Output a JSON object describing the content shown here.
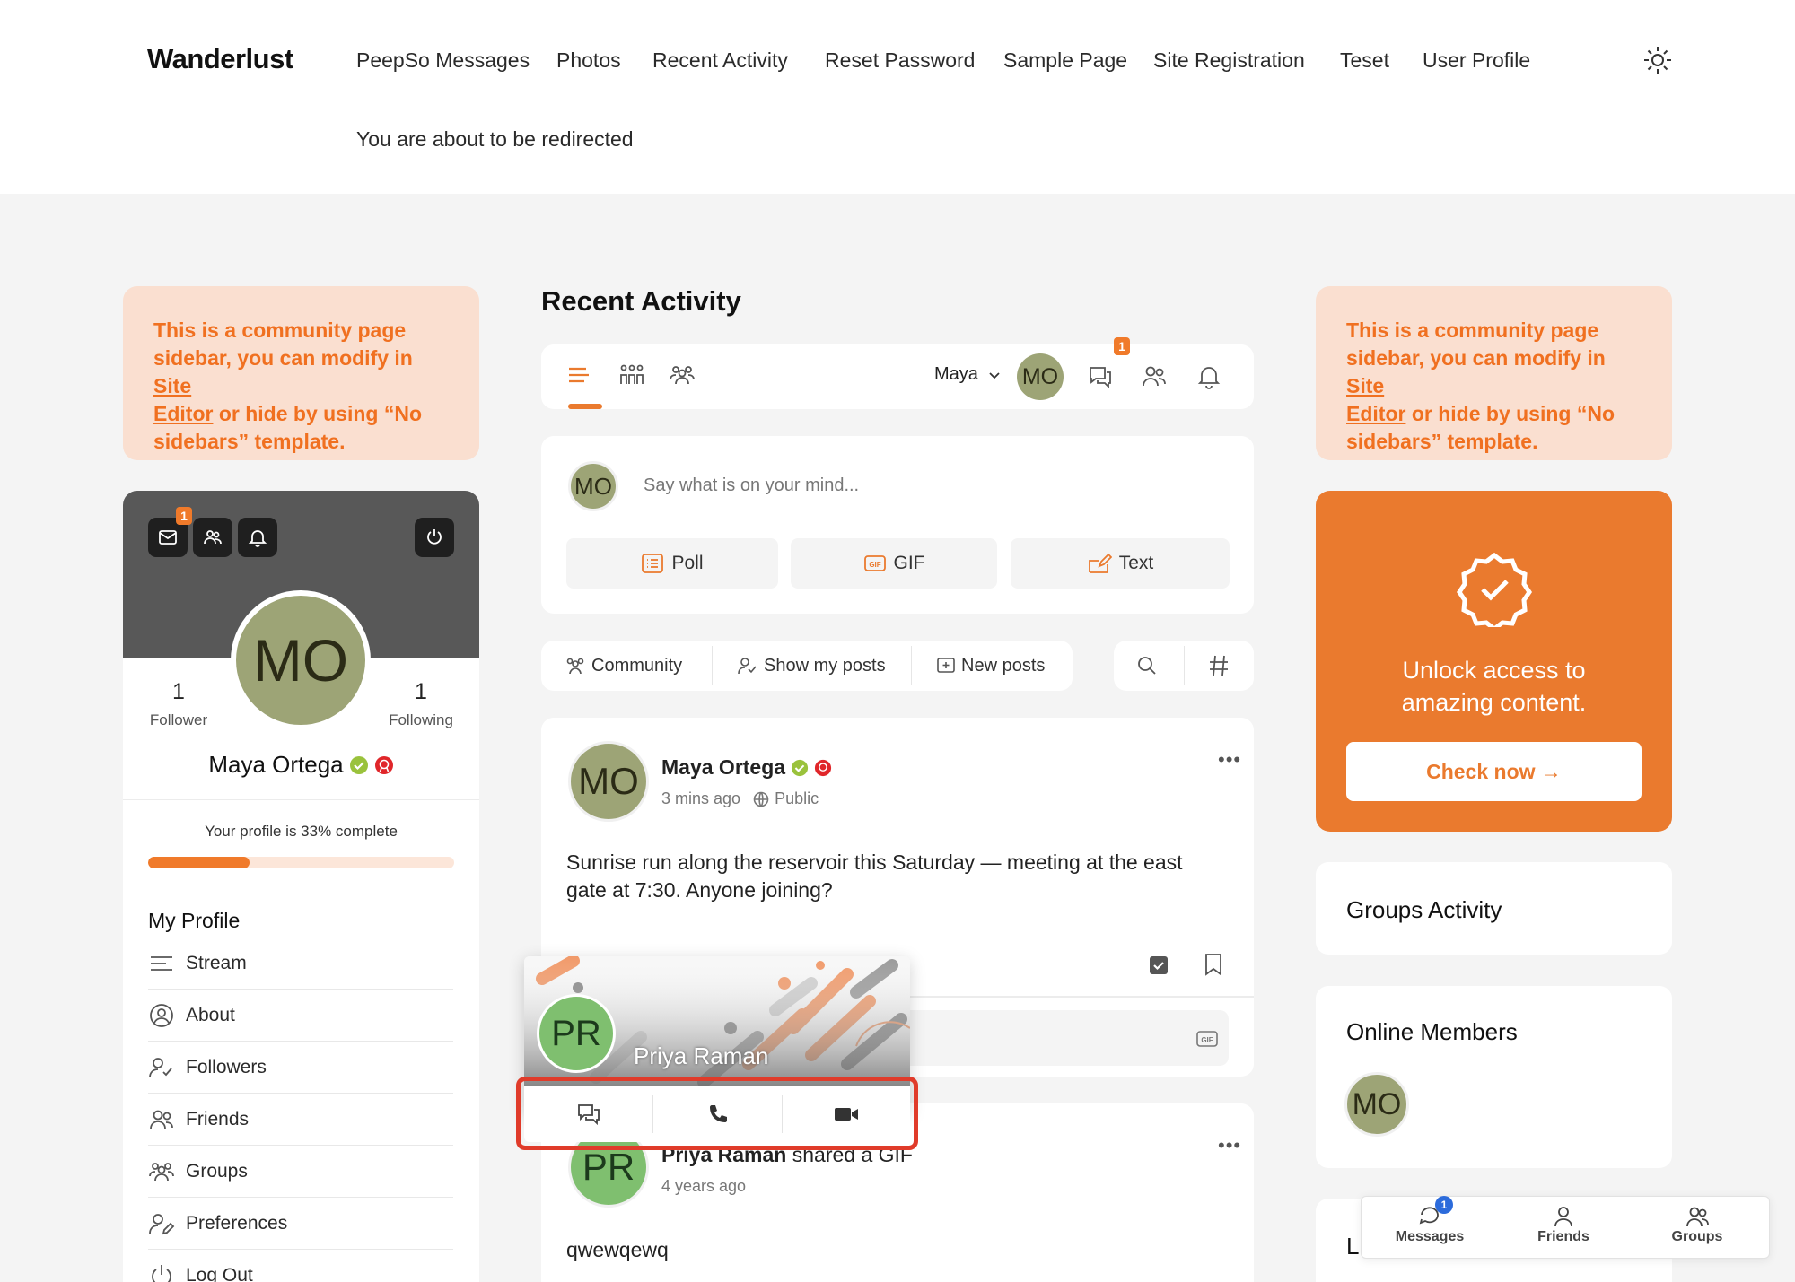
{
  "site": {
    "brand": "Wanderlust"
  },
  "nav": {
    "items": [
      "PeepSo Messages",
      "Photos",
      "Recent Activity",
      "Reset Password",
      "Sample Page",
      "Site Registration",
      "Teset",
      "User Profile"
    ],
    "redirect_text": "You are about to be redirected"
  },
  "sidebar_notice": {
    "line1": "This is a community page",
    "line2_pre": "sidebar, you can modify in ",
    "link1": "Site",
    "link2": "Editor",
    "line3_post": " or hide by using “No",
    "line4": "sidebars” template."
  },
  "profile": {
    "initials": "MO",
    "name": "Maya Ortega",
    "message_badge": "1",
    "followers_count": "1",
    "followers_label": "Follower",
    "following_count": "1",
    "following_label": "Following",
    "complete_text": "Your profile is 33% complete",
    "complete_fraction": 0.33,
    "section_title": "My Profile",
    "menu": [
      "Stream",
      "About",
      "Followers",
      "Friends",
      "Groups",
      "Preferences",
      "Log Out"
    ]
  },
  "main": {
    "title": "Recent Activity",
    "toolbar": {
      "user": "Maya",
      "initials": "MO",
      "message_badge": "1"
    },
    "composer": {
      "placeholder": "Say what is on your mind...",
      "buttons": [
        "Poll",
        "GIF",
        "Text"
      ]
    },
    "filters": [
      "Community",
      "Show my posts",
      "New posts"
    ],
    "post1": {
      "author": "Maya Ortega",
      "initials": "MO",
      "time": "3 mins ago",
      "privacy": "Public",
      "body_line1": "Sunrise run along the reservoir this Saturday — meeting at the east",
      "body_line2": "gate at 7:30. Anyone joining?"
    },
    "post2": {
      "author": "Priya Raman",
      "action": "shared a GIF",
      "initials": "PR",
      "time": "4 years ago",
      "body": "qwewqewq"
    },
    "hover_card": {
      "name": "Priya Raman",
      "initials": "PR"
    }
  },
  "right": {
    "unlock_line1": "Unlock access to",
    "unlock_line2": "amazing content.",
    "check_now": "Check now →",
    "groups_activity": "Groups Activity",
    "online_members": "Online Members",
    "online_initials": "MO",
    "partial_label": "L"
  },
  "bottom_nav": {
    "items": [
      "Messages",
      "Friends",
      "Groups"
    ],
    "messages_badge": "1"
  },
  "colors": {
    "accent": "#ea7a2e",
    "avatar": "#9da476",
    "avatar_pr": "#7fbf6f",
    "highlight": "#e03b2a"
  }
}
